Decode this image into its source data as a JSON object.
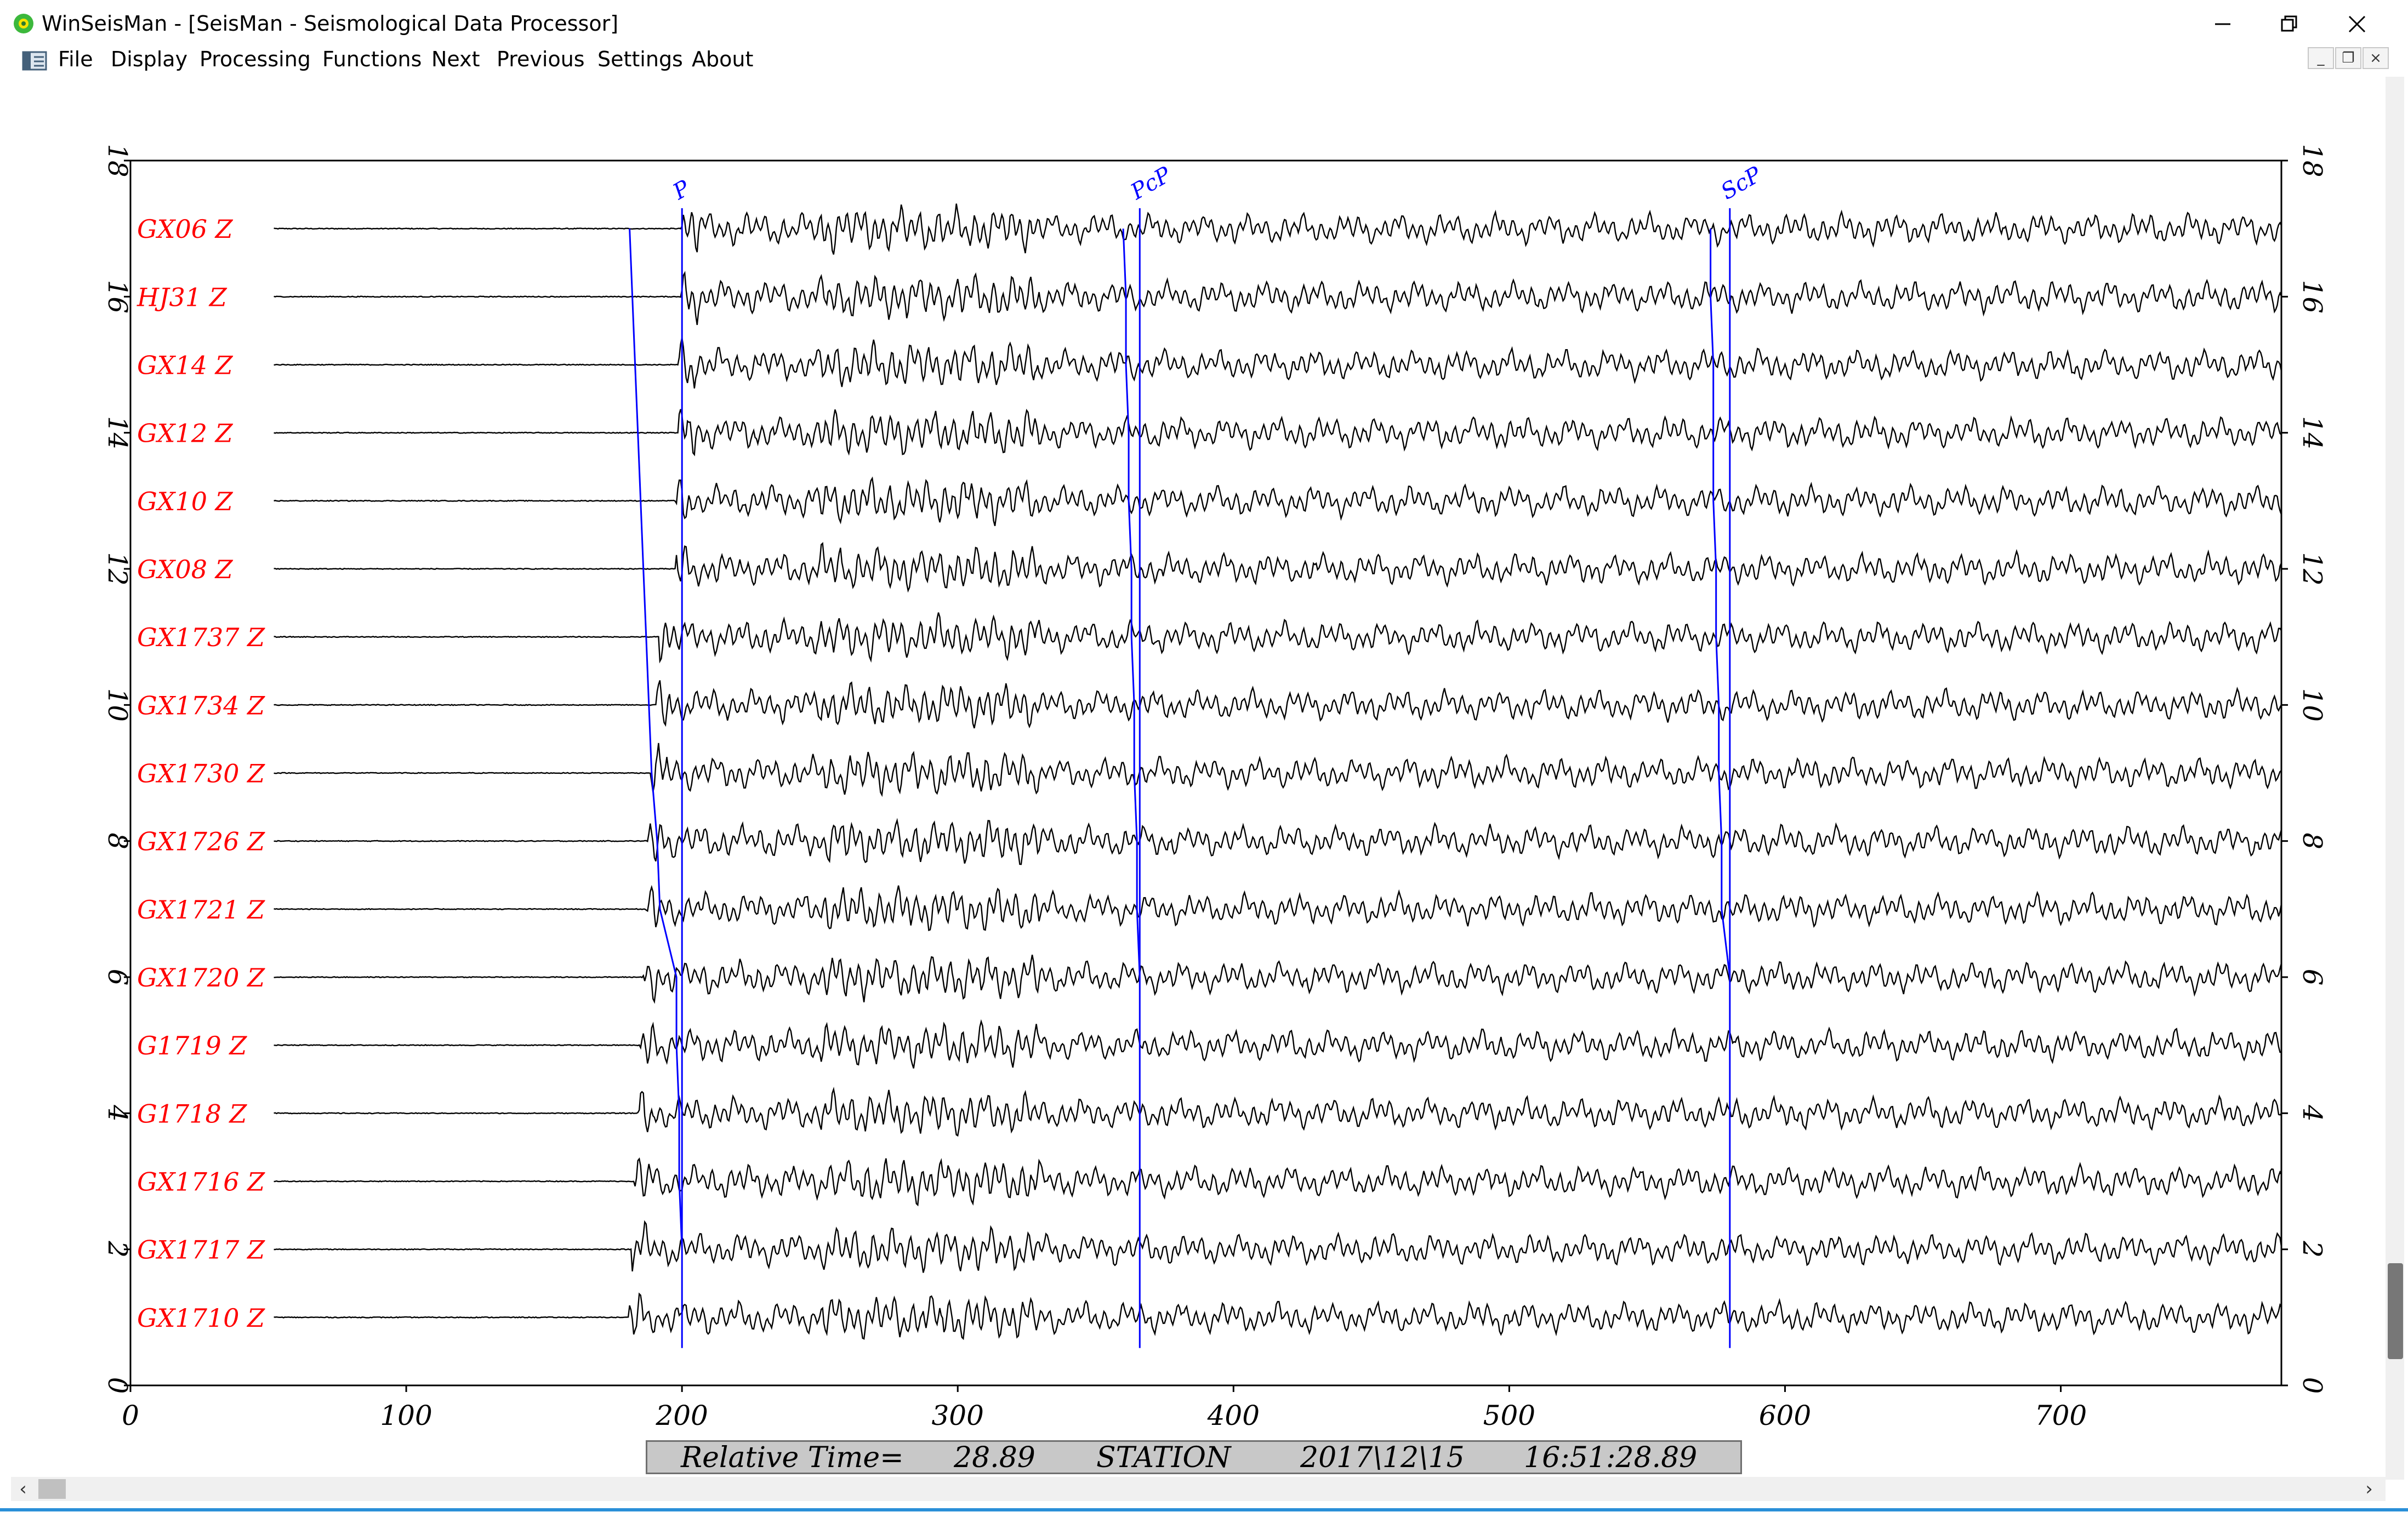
{
  "window": {
    "title": "WinSeisMan - [SeisMan - Seismological Data Processor]",
    "controls": [
      "minimize",
      "restore",
      "close"
    ]
  },
  "menu": [
    "File",
    "Display",
    "Processing",
    "Functions",
    "Next",
    "Previous",
    "Settings",
    "About"
  ],
  "chart_data": {
    "type": "line",
    "xlim": [
      0,
      780
    ],
    "ylim": [
      0,
      18
    ],
    "xticks": [
      0,
      100,
      200,
      300,
      400,
      500,
      600,
      700
    ],
    "yticks": [
      0,
      2,
      4,
      6,
      8,
      10,
      12,
      14,
      16,
      18
    ],
    "trace_color": "#000000",
    "label_color": "#ff0000",
    "phase_color": "#0000ff",
    "series": [
      {
        "name": "GX06 Z",
        "y": 17,
        "p_arrival": 200
      },
      {
        "name": "HJ31 Z",
        "y": 16,
        "p_arrival": 200
      },
      {
        "name": "GX14 Z",
        "y": 15,
        "p_arrival": 199
      },
      {
        "name": "GX12 Z",
        "y": 14,
        "p_arrival": 199
      },
      {
        "name": "GX10 Z",
        "y": 13,
        "p_arrival": 198
      },
      {
        "name": "GX08 Z",
        "y": 12,
        "p_arrival": 198
      },
      {
        "name": "GX1737 Z",
        "y": 11,
        "p_arrival": 192
      },
      {
        "name": "GX1734 Z",
        "y": 10,
        "p_arrival": 191
      },
      {
        "name": "GX1730 Z",
        "y": 9,
        "p_arrival": 189
      },
      {
        "name": "GX1726 Z",
        "y": 8,
        "p_arrival": 188
      },
      {
        "name": "GX1721 Z",
        "y": 7,
        "p_arrival": 187
      },
      {
        "name": "GX1720 Z",
        "y": 6,
        "p_arrival": 186
      },
      {
        "name": "G1719 Z",
        "y": 5,
        "p_arrival": 185
      },
      {
        "name": "G1718 Z",
        "y": 4,
        "p_arrival": 184
      },
      {
        "name": "GX1716 Z",
        "y": 3,
        "p_arrival": 183
      },
      {
        "name": "GX1717 Z",
        "y": 2,
        "p_arrival": 182
      },
      {
        "name": "GX1710 Z",
        "y": 1,
        "p_arrival": 181
      }
    ],
    "phases": [
      {
        "name": "P",
        "x": [
          181,
          182,
          183,
          184,
          185,
          186,
          187,
          188,
          189,
          191,
          192,
          198,
          198,
          199,
          199,
          200,
          200
        ]
      },
      {
        "name": "PcP",
        "x": [
          360,
          361,
          361,
          362,
          362,
          363,
          363,
          364,
          364,
          365,
          365,
          366,
          366,
          366,
          366,
          366,
          366
        ]
      },
      {
        "name": "ScP",
        "x": [
          573,
          573,
          574,
          574,
          574,
          575,
          575,
          576,
          576,
          577,
          577,
          580,
          580,
          580,
          580,
          580,
          580
        ]
      }
    ]
  },
  "status": {
    "relative_time_label": "Relative Time=",
    "relative_time_value": "28.89",
    "station": "STATION",
    "date": "2017\\12\\15",
    "time": "16:51:28.89"
  }
}
